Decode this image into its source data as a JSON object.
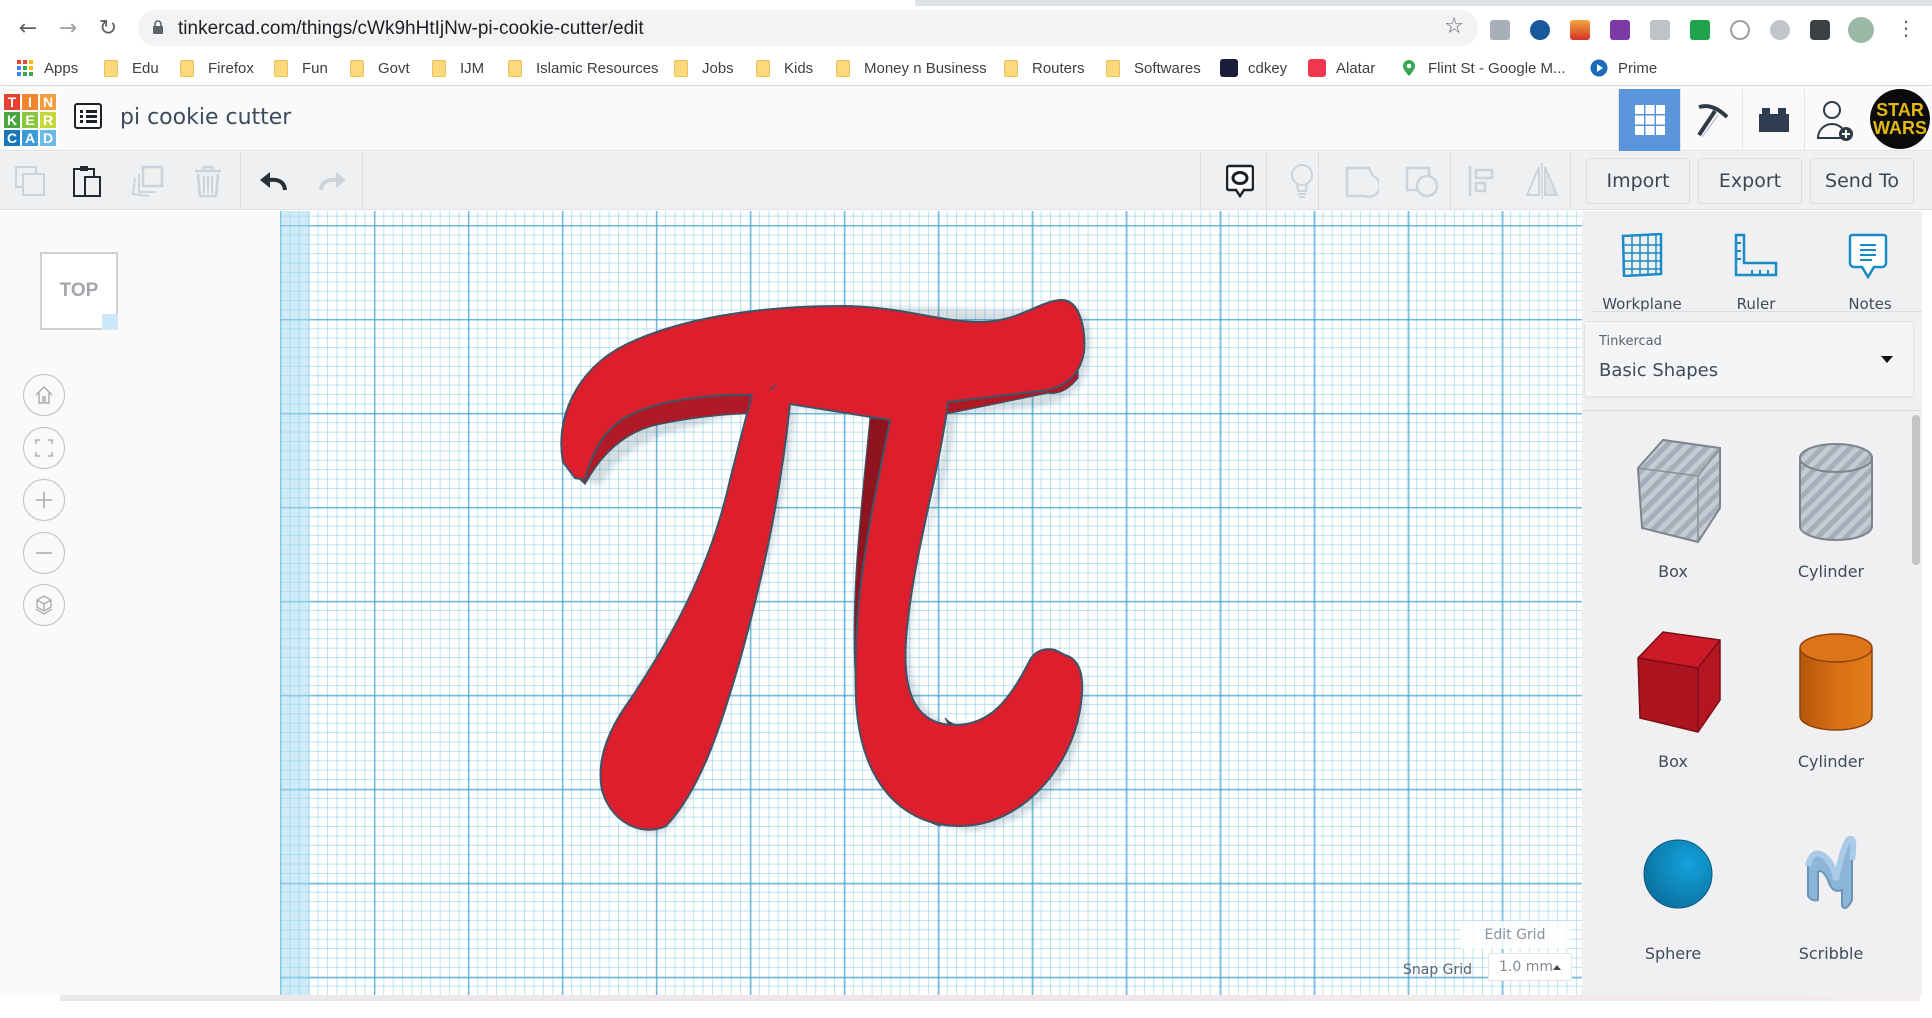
{
  "browser": {
    "url": "tinkercad.com/things/cWk9hHtIjNw-pi-cookie-cutter/edit",
    "nav": {
      "back": "back-icon",
      "forward": "forward-icon",
      "reload": "reload-icon"
    },
    "bookmarks": [
      {
        "label": "Apps",
        "icon": "apps-grid-icon"
      },
      {
        "label": "Edu",
        "icon": "folder-icon"
      },
      {
        "label": "Firefox",
        "icon": "folder-icon"
      },
      {
        "label": "Fun",
        "icon": "folder-icon"
      },
      {
        "label": "Govt",
        "icon": "folder-icon"
      },
      {
        "label": "IJM",
        "icon": "folder-icon"
      },
      {
        "label": "Islamic Resources",
        "icon": "folder-icon"
      },
      {
        "label": "Jobs",
        "icon": "folder-icon"
      },
      {
        "label": "Kids",
        "icon": "folder-icon"
      },
      {
        "label": "Money n Business",
        "icon": "folder-icon"
      },
      {
        "label": "Routers",
        "icon": "folder-icon"
      },
      {
        "label": "Softwares",
        "icon": "folder-icon"
      },
      {
        "label": "cdkey",
        "icon": "cdk-icon"
      },
      {
        "label": "Alatar",
        "icon": "music-icon"
      },
      {
        "label": "Flint St - Google M...",
        "icon": "maps-pin-icon"
      },
      {
        "label": "Prime",
        "icon": "play-icon"
      }
    ]
  },
  "app": {
    "logo_letters": [
      "T",
      "I",
      "N",
      "K",
      "E",
      "R",
      "C",
      "A",
      "D"
    ],
    "logo_colors": [
      "#e8412e",
      "#f2862e",
      "#f59d3a",
      "#4aa541",
      "#8ac640",
      "#c6d73b",
      "#1a76bc",
      "#3b9ad9",
      "#6bbae6"
    ],
    "design_title": "pi cookie cutter",
    "avatar_text": "STAR WARS"
  },
  "toolbar": {
    "import_label": "Import",
    "export_label": "Export",
    "send_to_label": "Send To"
  },
  "left_panel": {
    "viewcube_label": "TOP"
  },
  "canvas": {
    "shape": "pi",
    "shape_color": "#dc1e2d",
    "edit_grid_label": "Edit Grid",
    "snap_grid_label": "Snap Grid",
    "snap_grid_value": "1.0 mm"
  },
  "right_panel": {
    "tools": [
      {
        "label": "Workplane",
        "icon": "workplane-icon"
      },
      {
        "label": "Ruler",
        "icon": "ruler-icon"
      },
      {
        "label": "Notes",
        "icon": "notes-icon"
      }
    ],
    "library_category": "Tinkercad",
    "library_value": "Basic Shapes",
    "shapes": [
      {
        "label": "Box",
        "kind": "hole-box"
      },
      {
        "label": "Cylinder",
        "kind": "hole-cylinder"
      },
      {
        "label": "Box",
        "kind": "box"
      },
      {
        "label": "Cylinder",
        "kind": "cylinder"
      },
      {
        "label": "Sphere",
        "kind": "sphere"
      },
      {
        "label": "Scribble",
        "kind": "scribble"
      }
    ]
  }
}
